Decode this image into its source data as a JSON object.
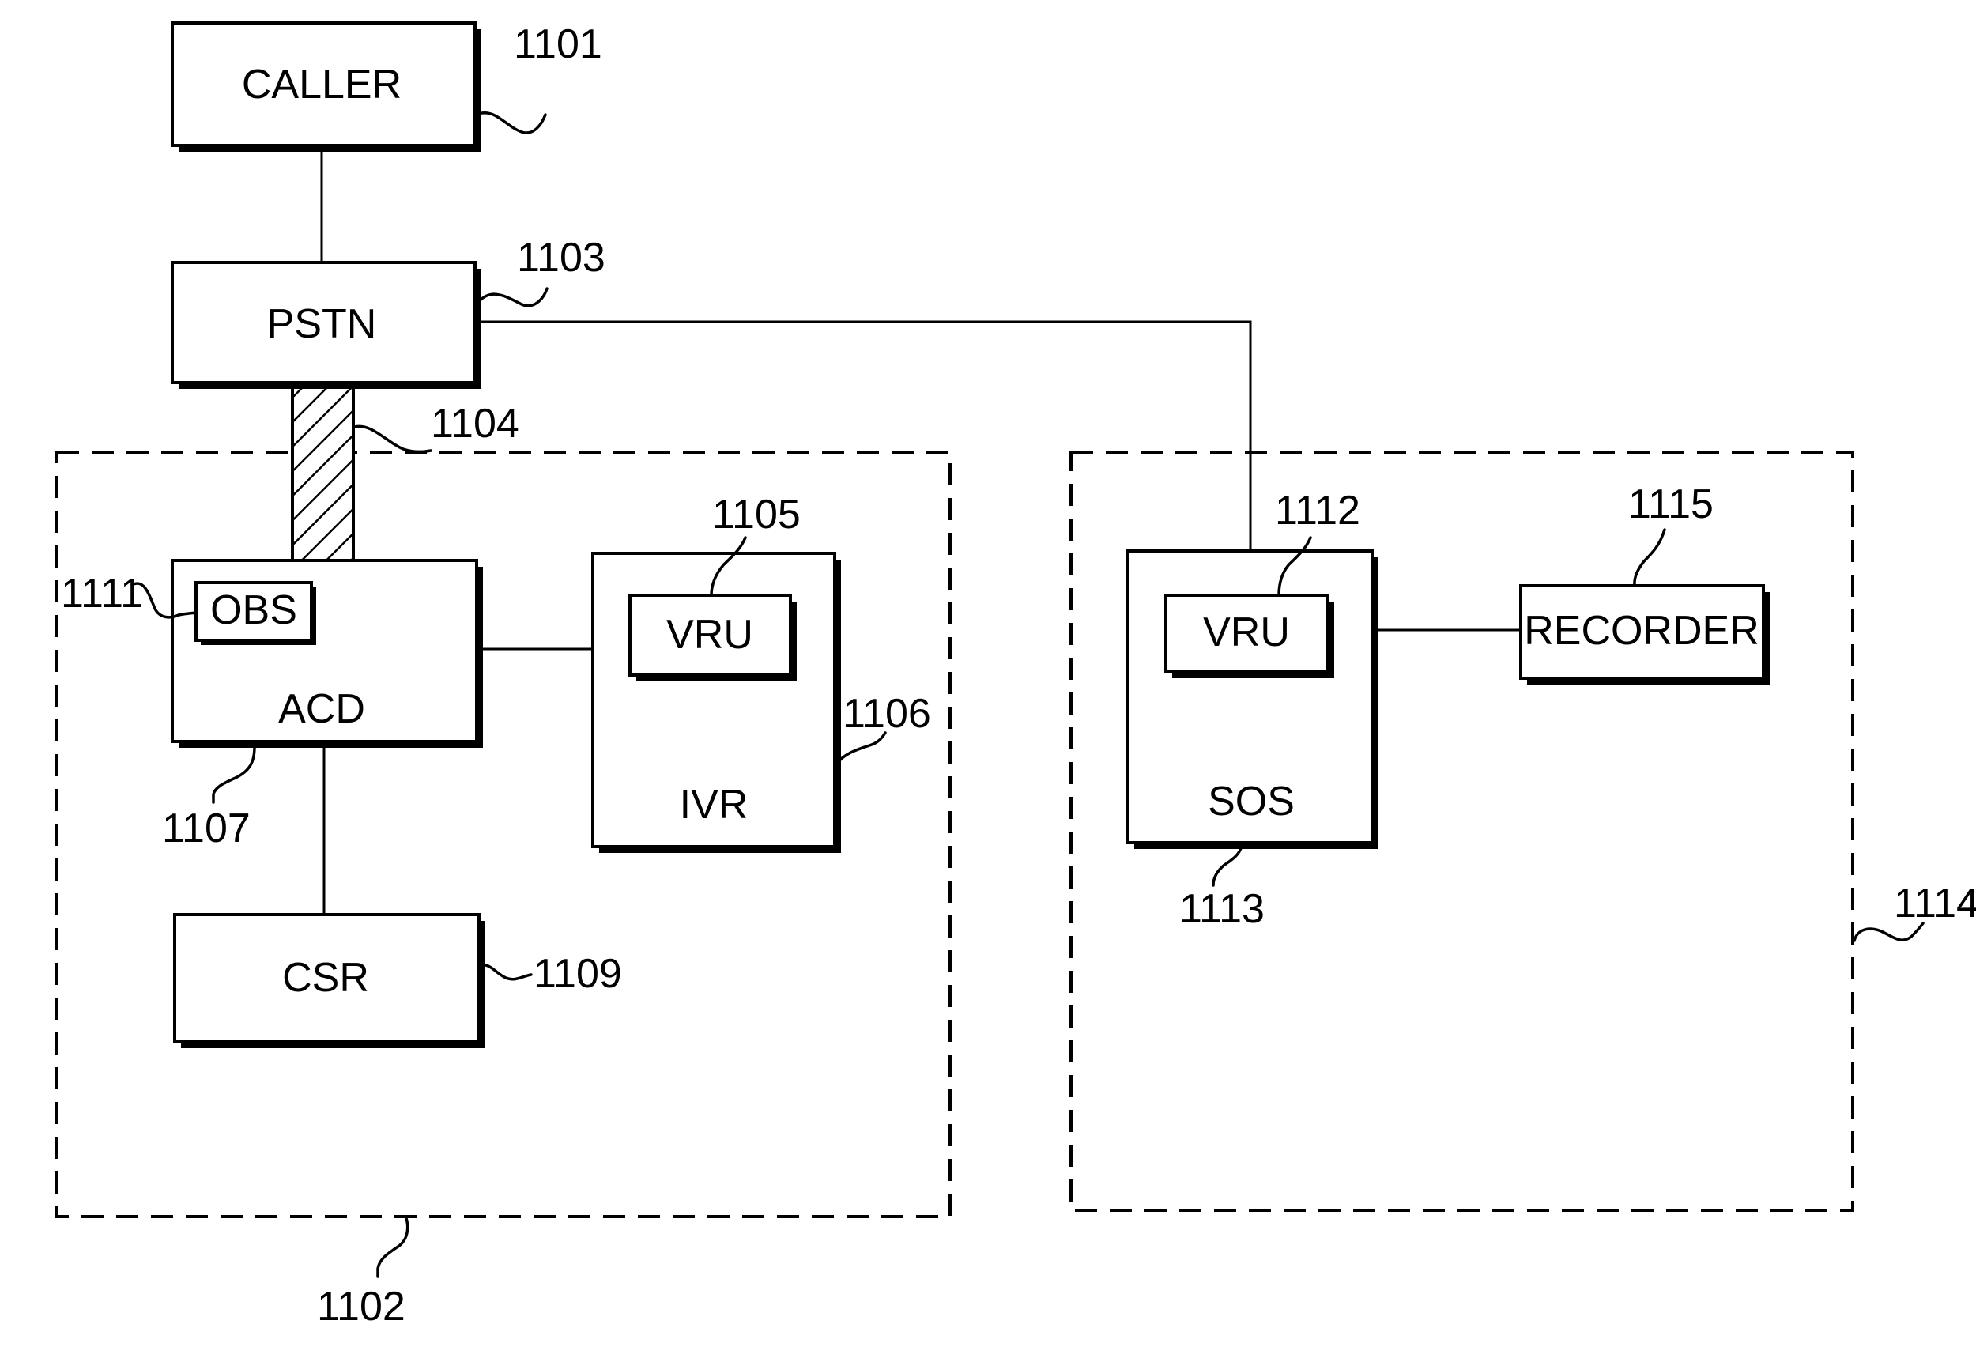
{
  "figure": {
    "type": "block-diagram",
    "colors": {
      "stroke": "#000000",
      "background": "#ffffff"
    }
  },
  "blocks": {
    "caller": {
      "label": "CALLER",
      "ref": "1101"
    },
    "pstn": {
      "label": "PSTN",
      "ref": "1103"
    },
    "trunk": {
      "label": "",
      "ref": "1104"
    },
    "call_center": {
      "label": "",
      "ref": "1102"
    },
    "acd": {
      "label": "ACD",
      "ref": "1107"
    },
    "obs": {
      "label": "OBS",
      "ref": "1111"
    },
    "ivr": {
      "label": "IVR",
      "ref": "1106"
    },
    "ivr_vru": {
      "label": "VRU",
      "ref": "1105"
    },
    "csr": {
      "label": "CSR",
      "ref": "1109"
    },
    "remote_site": {
      "label": "",
      "ref": "1114"
    },
    "sos": {
      "label": "SOS",
      "ref": "1113"
    },
    "sos_vru": {
      "label": "VRU",
      "ref": "1112"
    },
    "recorder": {
      "label": "RECORDER",
      "ref": "1115"
    }
  },
  "connections": [
    {
      "from": "caller",
      "to": "pstn"
    },
    {
      "from": "pstn",
      "to": "acd",
      "via": "trunk"
    },
    {
      "from": "pstn",
      "to": "sos"
    },
    {
      "from": "acd",
      "to": "ivr"
    },
    {
      "from": "acd",
      "to": "csr"
    },
    {
      "from": "sos",
      "to": "recorder"
    }
  ]
}
